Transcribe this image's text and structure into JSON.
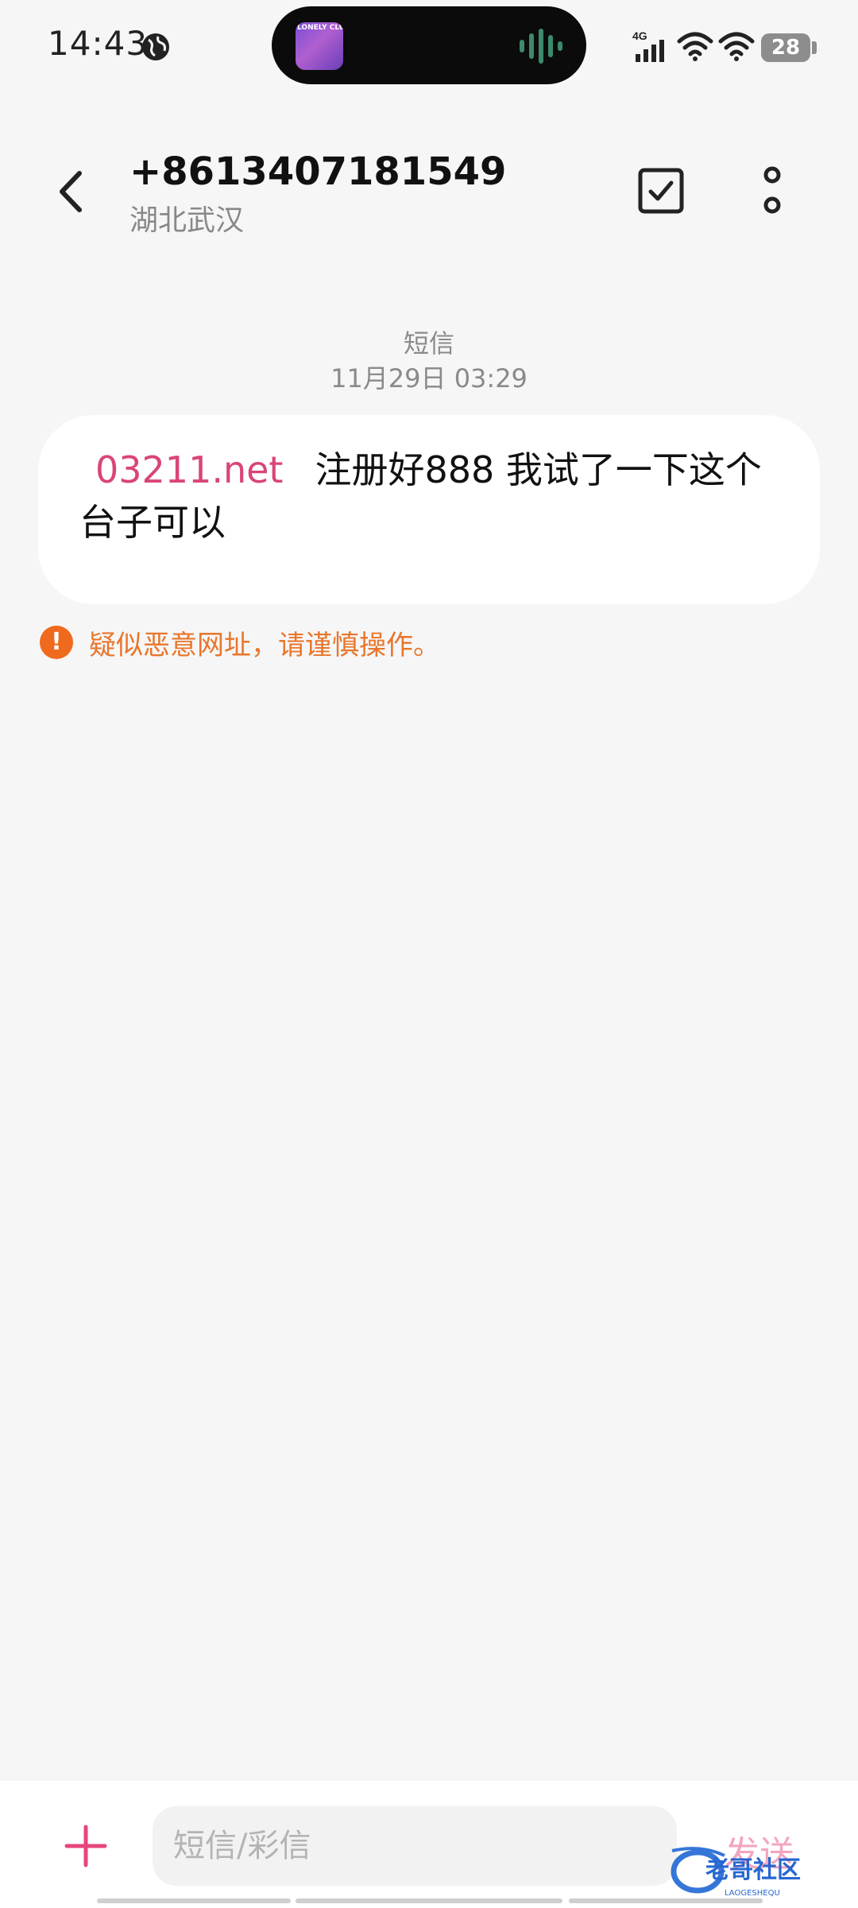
{
  "status_bar": {
    "time": "14:43",
    "network_type": "4G",
    "battery": "28",
    "island_art_label": "LONELY CLUB"
  },
  "header": {
    "contact_number": "+8613407181549",
    "contact_location": "湖北武汉"
  },
  "conversation": {
    "message_type": "短信",
    "message_date": "11月29日 03:29",
    "message": {
      "link": "03211.net",
      "text_line1": "注册好888 我试了一下这个",
      "text_line2": "台子可以"
    },
    "warning_text": "疑似恶意网址，请谨慎操作。"
  },
  "composer": {
    "placeholder": "短信/彩信",
    "send_label": "发送",
    "watermark_text": "老哥社区",
    "watermark_sub": "LAOGESHEQU"
  },
  "colors": {
    "link": "#d94479",
    "warning": "#e8762c",
    "accent_add": "#e8457e",
    "background": "#f6f6f6"
  },
  "icons": [
    "globe-icon",
    "signal-4g-icon",
    "wifi-icon",
    "battery-icon",
    "back-arrow-icon",
    "checkbox-select-icon",
    "more-vertical-icon",
    "warning-icon",
    "plus-icon"
  ]
}
